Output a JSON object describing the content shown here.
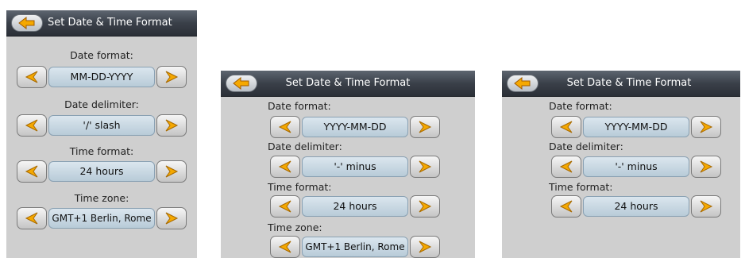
{
  "screens": [
    {
      "title": "Set Date & Time Format",
      "date_format": {
        "label": "Date format:",
        "value": "MM-DD-YYYY"
      },
      "date_delimiter": {
        "label": "Date delimiter:",
        "value": "'/' slash"
      },
      "time_format": {
        "label": "Time format:",
        "value": "24 hours"
      },
      "time_zone": {
        "label": "Time zone:",
        "value": "GMT+1 Berlin, Rome"
      }
    },
    {
      "title": "Set Date & Time Format",
      "date_format": {
        "label": "Date format:",
        "value": "YYYY-MM-DD"
      },
      "date_delimiter": {
        "label": "Date delimiter:",
        "value": "'-' minus"
      },
      "time_format": {
        "label": "Time format:",
        "value": "24 hours"
      },
      "time_zone": {
        "label": "Time zone:",
        "value": "GMT+1 Berlin, Rome"
      }
    },
    {
      "title": "Set Date & Time Format",
      "date_format": {
        "label": "Date format:",
        "value": "YYYY-MM-DD"
      },
      "date_delimiter": {
        "label": "Date delimiter:",
        "value": "'-' minus"
      },
      "time_format": {
        "label": "Time format:",
        "value": "24 hours"
      }
    }
  ],
  "icons": {
    "back": "back-arrow-icon",
    "prev": "left-arrow-icon",
    "next": "right-arrow-icon"
  },
  "colors": {
    "panel_bg": "#cfcfcf",
    "titlebar": "#3a4049",
    "value_bar": "#c9d8e3",
    "arrow": "#f5a800"
  }
}
